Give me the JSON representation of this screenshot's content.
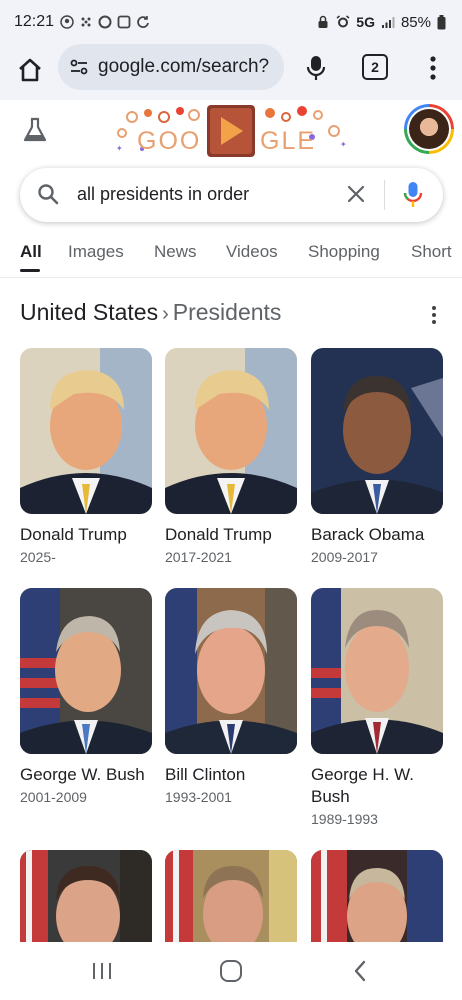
{
  "status_bar": {
    "time": "12:21",
    "network": "5G",
    "battery": "85%"
  },
  "toolbar": {
    "url": "google.com/search?",
    "tab_count": "2"
  },
  "header": {
    "doodle_letters_left": "GOO",
    "doodle_letters_right": "GLE"
  },
  "search": {
    "query": "all presidents in order"
  },
  "tabs": [
    {
      "label": "All"
    },
    {
      "label": "Images"
    },
    {
      "label": "News"
    },
    {
      "label": "Videos"
    },
    {
      "label": "Shopping"
    },
    {
      "label": "Short"
    }
  ],
  "section": {
    "title": "United States",
    "separator": "›",
    "subtitle": "Presidents"
  },
  "presidents": [
    {
      "name": "Donald Trump",
      "years": "2025-"
    },
    {
      "name": "Donald Trump",
      "years": "2017-2021"
    },
    {
      "name": "Barack Obama",
      "years": "2009-2017"
    },
    {
      "name": "George W. Bush",
      "years": "2001-2009"
    },
    {
      "name": "Bill Clinton",
      "years": "1993-2001"
    },
    {
      "name": "George H. W. Bush",
      "years": "1989-1993"
    }
  ],
  "colors": {
    "accent": "#202124",
    "secondary_text": "#5f6368",
    "google_blue": "#4285f4",
    "google_red": "#ea4335",
    "google_yellow": "#fbbc04",
    "google_green": "#34a853"
  }
}
